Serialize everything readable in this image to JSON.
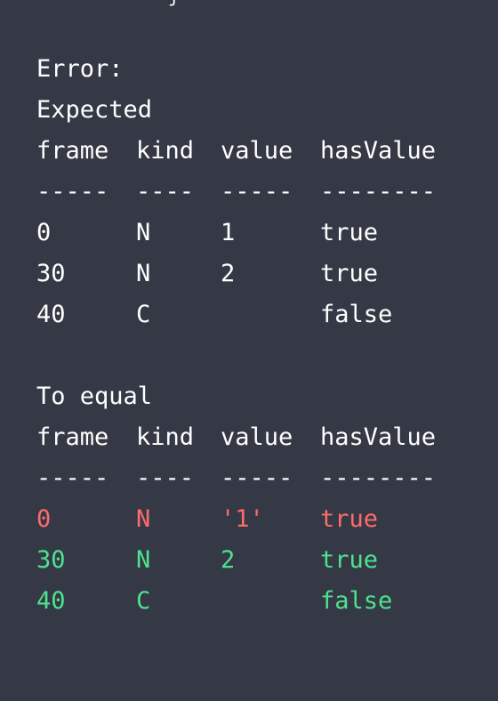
{
  "top_fragment": "j",
  "error_label": "Error:",
  "expected": {
    "label": "Expected",
    "headers": [
      "frame",
      "kind",
      "value",
      "hasValue"
    ],
    "dashes": [
      "-----",
      "----",
      "-----",
      "--------"
    ],
    "rows": [
      [
        "0",
        "N",
        "1",
        "true"
      ],
      [
        "30",
        "N",
        "2",
        "true"
      ],
      [
        "40",
        "C",
        "",
        "false"
      ]
    ]
  },
  "actual": {
    "label": "To equal",
    "headers": [
      "frame",
      "kind",
      "value",
      "hasValue"
    ],
    "dashes": [
      "-----",
      "----",
      "-----",
      "--------"
    ],
    "rows": [
      [
        "0",
        "N",
        "'1'",
        "true"
      ],
      [
        "30",
        "N",
        "2",
        "true"
      ],
      [
        "40",
        "C",
        "",
        "false"
      ]
    ]
  },
  "colors": {
    "background": "#353945",
    "text": "#ffffff",
    "mismatch": "#ff6b6b",
    "match": "#4ee28f"
  }
}
